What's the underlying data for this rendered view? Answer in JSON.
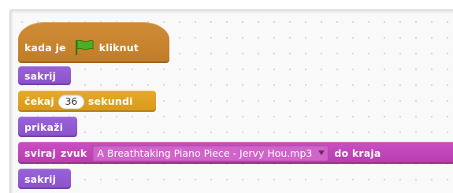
{
  "script": {
    "when_flag_clicked": {
      "before": "kada je",
      "after": "kliknut",
      "flag_icon": "green-flag-icon"
    },
    "hide_1": {
      "label": "sakrij"
    },
    "wait": {
      "label": "čekaj",
      "value": "36",
      "unit": "sekundi"
    },
    "show": {
      "label": "prikaži"
    },
    "play_sound": {
      "word1": "sviraj",
      "word2": "zvuk",
      "sound": "A Breathtaking Piano Piece - Jervy Hou.mp3",
      "suffix": "do kraja"
    },
    "hide_2": {
      "label": "sakrij"
    }
  },
  "colors": {
    "events": "#c88330",
    "looks": "#8a55d7",
    "control": "#e1a91a",
    "sound": "#bb42c3",
    "flag": "#3f9a1e"
  }
}
